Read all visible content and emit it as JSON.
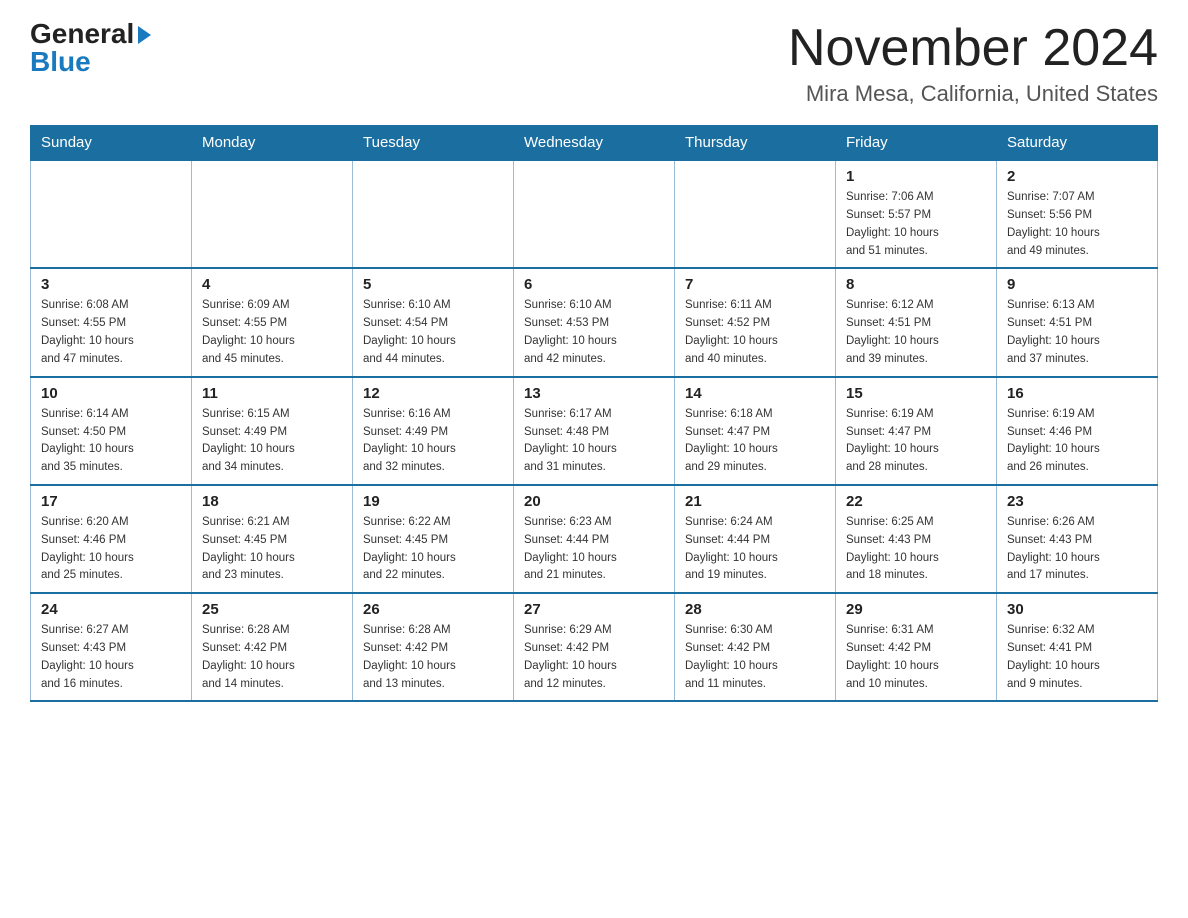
{
  "header": {
    "logo_general": "General",
    "logo_blue": "Blue",
    "month_title": "November 2024",
    "location": "Mira Mesa, California, United States"
  },
  "days_of_week": [
    "Sunday",
    "Monday",
    "Tuesday",
    "Wednesday",
    "Thursday",
    "Friday",
    "Saturday"
  ],
  "weeks": [
    [
      {
        "day": "",
        "info": ""
      },
      {
        "day": "",
        "info": ""
      },
      {
        "day": "",
        "info": ""
      },
      {
        "day": "",
        "info": ""
      },
      {
        "day": "",
        "info": ""
      },
      {
        "day": "1",
        "info": "Sunrise: 7:06 AM\nSunset: 5:57 PM\nDaylight: 10 hours\nand 51 minutes."
      },
      {
        "day": "2",
        "info": "Sunrise: 7:07 AM\nSunset: 5:56 PM\nDaylight: 10 hours\nand 49 minutes."
      }
    ],
    [
      {
        "day": "3",
        "info": "Sunrise: 6:08 AM\nSunset: 4:55 PM\nDaylight: 10 hours\nand 47 minutes."
      },
      {
        "day": "4",
        "info": "Sunrise: 6:09 AM\nSunset: 4:55 PM\nDaylight: 10 hours\nand 45 minutes."
      },
      {
        "day": "5",
        "info": "Sunrise: 6:10 AM\nSunset: 4:54 PM\nDaylight: 10 hours\nand 44 minutes."
      },
      {
        "day": "6",
        "info": "Sunrise: 6:10 AM\nSunset: 4:53 PM\nDaylight: 10 hours\nand 42 minutes."
      },
      {
        "day": "7",
        "info": "Sunrise: 6:11 AM\nSunset: 4:52 PM\nDaylight: 10 hours\nand 40 minutes."
      },
      {
        "day": "8",
        "info": "Sunrise: 6:12 AM\nSunset: 4:51 PM\nDaylight: 10 hours\nand 39 minutes."
      },
      {
        "day": "9",
        "info": "Sunrise: 6:13 AM\nSunset: 4:51 PM\nDaylight: 10 hours\nand 37 minutes."
      }
    ],
    [
      {
        "day": "10",
        "info": "Sunrise: 6:14 AM\nSunset: 4:50 PM\nDaylight: 10 hours\nand 35 minutes."
      },
      {
        "day": "11",
        "info": "Sunrise: 6:15 AM\nSunset: 4:49 PM\nDaylight: 10 hours\nand 34 minutes."
      },
      {
        "day": "12",
        "info": "Sunrise: 6:16 AM\nSunset: 4:49 PM\nDaylight: 10 hours\nand 32 minutes."
      },
      {
        "day": "13",
        "info": "Sunrise: 6:17 AM\nSunset: 4:48 PM\nDaylight: 10 hours\nand 31 minutes."
      },
      {
        "day": "14",
        "info": "Sunrise: 6:18 AM\nSunset: 4:47 PM\nDaylight: 10 hours\nand 29 minutes."
      },
      {
        "day": "15",
        "info": "Sunrise: 6:19 AM\nSunset: 4:47 PM\nDaylight: 10 hours\nand 28 minutes."
      },
      {
        "day": "16",
        "info": "Sunrise: 6:19 AM\nSunset: 4:46 PM\nDaylight: 10 hours\nand 26 minutes."
      }
    ],
    [
      {
        "day": "17",
        "info": "Sunrise: 6:20 AM\nSunset: 4:46 PM\nDaylight: 10 hours\nand 25 minutes."
      },
      {
        "day": "18",
        "info": "Sunrise: 6:21 AM\nSunset: 4:45 PM\nDaylight: 10 hours\nand 23 minutes."
      },
      {
        "day": "19",
        "info": "Sunrise: 6:22 AM\nSunset: 4:45 PM\nDaylight: 10 hours\nand 22 minutes."
      },
      {
        "day": "20",
        "info": "Sunrise: 6:23 AM\nSunset: 4:44 PM\nDaylight: 10 hours\nand 21 minutes."
      },
      {
        "day": "21",
        "info": "Sunrise: 6:24 AM\nSunset: 4:44 PM\nDaylight: 10 hours\nand 19 minutes."
      },
      {
        "day": "22",
        "info": "Sunrise: 6:25 AM\nSunset: 4:43 PM\nDaylight: 10 hours\nand 18 minutes."
      },
      {
        "day": "23",
        "info": "Sunrise: 6:26 AM\nSunset: 4:43 PM\nDaylight: 10 hours\nand 17 minutes."
      }
    ],
    [
      {
        "day": "24",
        "info": "Sunrise: 6:27 AM\nSunset: 4:43 PM\nDaylight: 10 hours\nand 16 minutes."
      },
      {
        "day": "25",
        "info": "Sunrise: 6:28 AM\nSunset: 4:42 PM\nDaylight: 10 hours\nand 14 minutes."
      },
      {
        "day": "26",
        "info": "Sunrise: 6:28 AM\nSunset: 4:42 PM\nDaylight: 10 hours\nand 13 minutes."
      },
      {
        "day": "27",
        "info": "Sunrise: 6:29 AM\nSunset: 4:42 PM\nDaylight: 10 hours\nand 12 minutes."
      },
      {
        "day": "28",
        "info": "Sunrise: 6:30 AM\nSunset: 4:42 PM\nDaylight: 10 hours\nand 11 minutes."
      },
      {
        "day": "29",
        "info": "Sunrise: 6:31 AM\nSunset: 4:42 PM\nDaylight: 10 hours\nand 10 minutes."
      },
      {
        "day": "30",
        "info": "Sunrise: 6:32 AM\nSunset: 4:41 PM\nDaylight: 10 hours\nand 9 minutes."
      }
    ]
  ]
}
